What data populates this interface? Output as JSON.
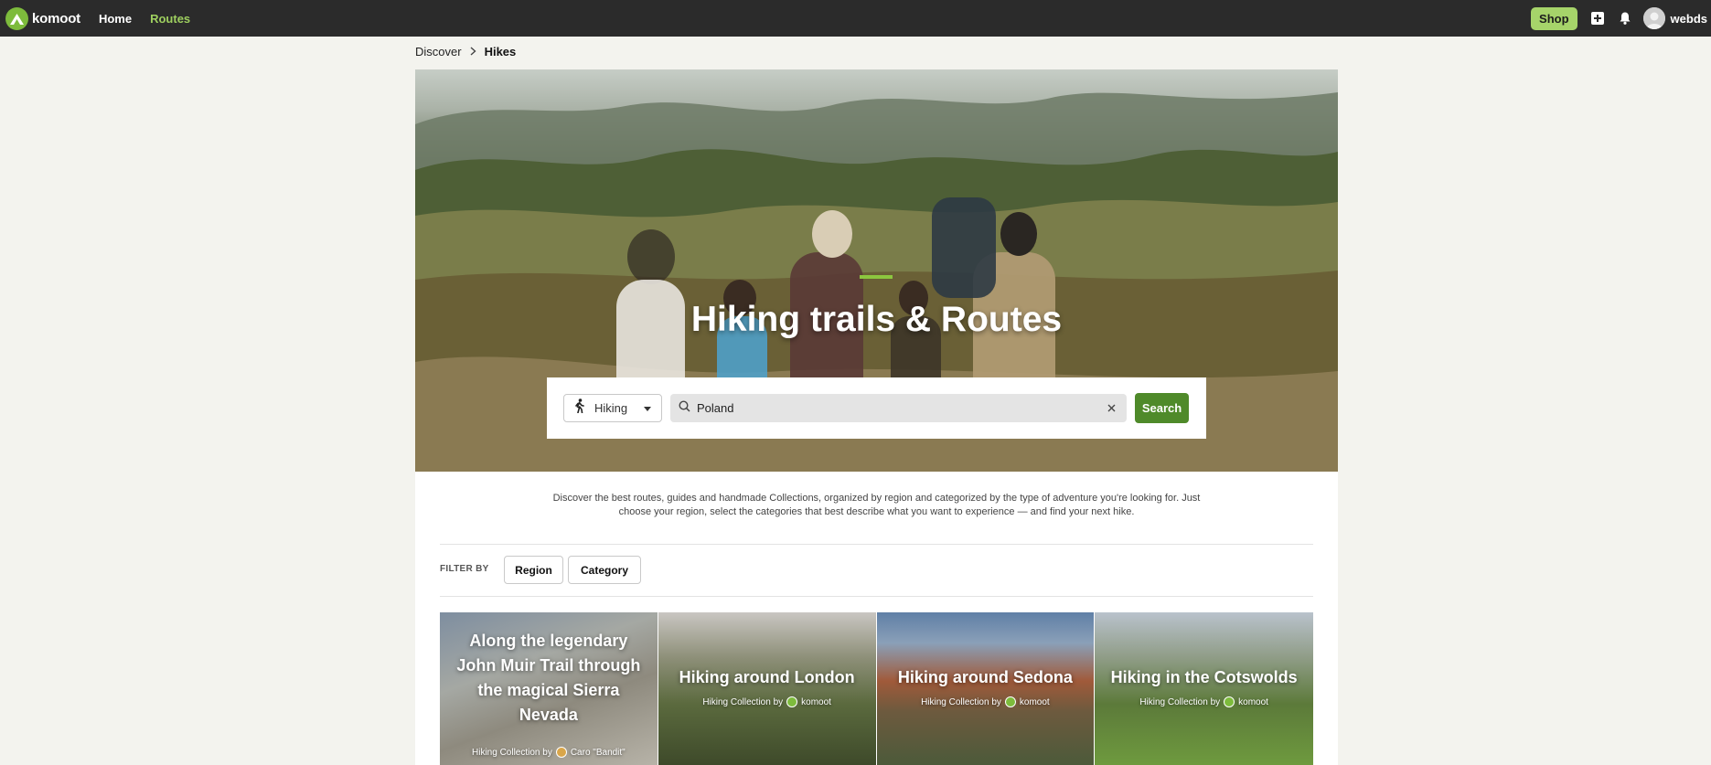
{
  "topbar": {
    "logo_text": "komoot",
    "nav": [
      {
        "label": "Home",
        "active": false
      },
      {
        "label": "Routes",
        "active": true
      }
    ],
    "shop_label": "Shop",
    "username": "webds",
    "icons": [
      "plus-icon",
      "bell-icon",
      "avatar"
    ]
  },
  "breadcrumb": {
    "parent": "Discover",
    "current": "Hikes"
  },
  "hero": {
    "title": "Hiking trails & Routes",
    "sport_select": {
      "label": "Hiking",
      "icon": "hiker-icon"
    },
    "search": {
      "value": "Poland",
      "placeholder": ""
    },
    "search_button": "Search"
  },
  "intro": "Discover the best routes, guides and handmade Collections, organized by region and categorized by the type of adventure you're looking for. Just choose your region, select the categories that best describe what you want to experience — and find your next hike.",
  "filters": {
    "label": "FILTER BY",
    "buttons": [
      "Region",
      "Category"
    ]
  },
  "collections": [
    {
      "title": "Along the legendary John Muir Trail through the magical Sierra Nevada",
      "prefix": "Hiking Collection by",
      "author": "Caro \"Bandit\""
    },
    {
      "title": "Hiking around London",
      "prefix": "Hiking Collection by",
      "author": "komoot"
    },
    {
      "title": "Hiking around Sedona",
      "prefix": "Hiking Collection by",
      "author": "komoot"
    },
    {
      "title": "Hiking in the Cotswolds",
      "prefix": "Hiking Collection by",
      "author": "komoot"
    }
  ],
  "colors": {
    "accent_green": "#8cc63f",
    "search_button": "#4f8a2a",
    "topbar": "#2b2b2b",
    "shop_button": "#a6d46a",
    "active_nav": "#9ecf5f"
  }
}
